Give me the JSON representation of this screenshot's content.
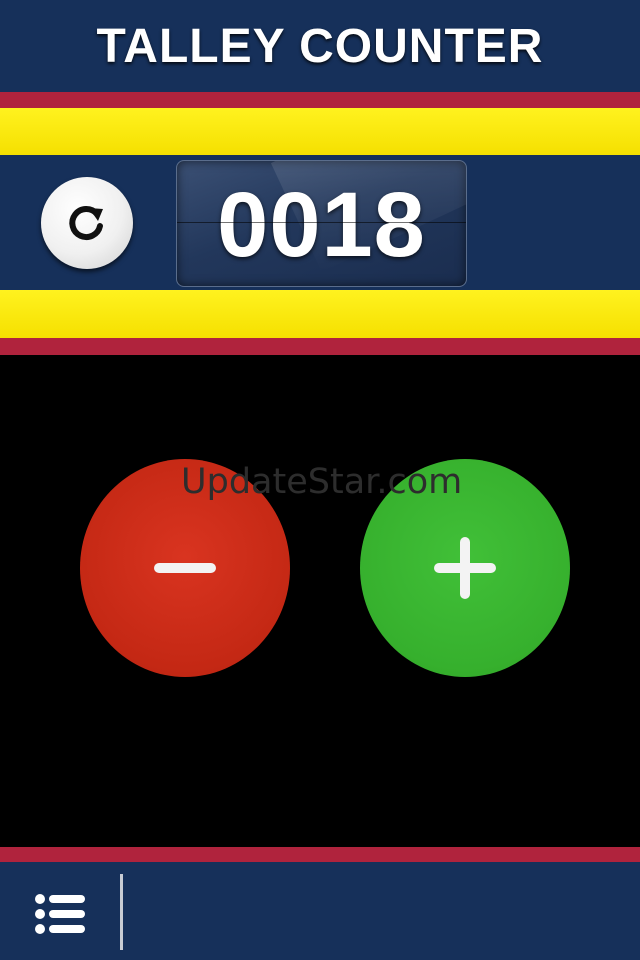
{
  "header": {
    "title": "TALLEY COUNTER"
  },
  "counter": {
    "value": "0018"
  },
  "controls": {
    "reset_icon": "refresh-icon",
    "decrement_icon": "minus-icon",
    "increment_icon": "plus-icon"
  },
  "watermark": "UpdateStar.com",
  "footer": {
    "menu_icon": "list-menu-icon"
  },
  "colors": {
    "navy": "#16305a",
    "red_stripe": "#b0233d",
    "yellow_stripe": "#fff21f",
    "decrement": "#c42814",
    "increment": "#36b02d"
  }
}
